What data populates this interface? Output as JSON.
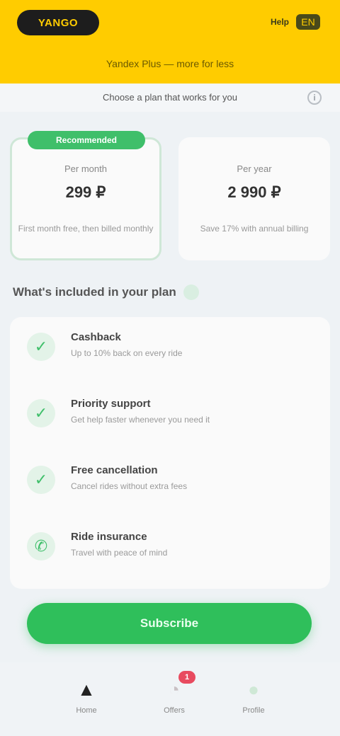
{
  "header": {
    "logo": "YANGO",
    "link": "Help",
    "lang": "EN",
    "subtitle": "Yandex Plus — more for less"
  },
  "strip": {
    "text": "Choose a plan that works for you",
    "info_icon": "info-icon",
    "info_glyph": "i"
  },
  "plans": [
    {
      "badge": "Recommended",
      "title": "Per month",
      "price": "299 ₽",
      "note": "First month free, then billed monthly"
    },
    {
      "title": "Per year",
      "price": "2 990 ₽",
      "note": "Save 17% with annual billing"
    }
  ],
  "section": {
    "title": "What's included in your plan"
  },
  "features": [
    {
      "icon": "check-circle-icon",
      "glyph": "✓",
      "title": "Cashback",
      "desc": "Up to 10% back on every ride"
    },
    {
      "icon": "shield-icon",
      "glyph": "✓",
      "title": "Priority support",
      "desc": "Get help faster whenever you need it"
    },
    {
      "icon": "check-icon",
      "glyph": "✓",
      "title": "Free cancellation",
      "desc": "Cancel rides without extra fees"
    },
    {
      "icon": "phone-icon",
      "glyph": "✆",
      "title": "Ride insurance",
      "desc": "Travel with peace of mind"
    }
  ],
  "cta": {
    "label": "Subscribe"
  },
  "nav": [
    {
      "icon": "home-icon",
      "glyph": "▲",
      "label": "Home"
    },
    {
      "icon": "bell-icon",
      "glyph": "◔",
      "label": "Offers",
      "badge": "1"
    },
    {
      "icon": "profile-icon",
      "glyph": "●",
      "label": "Profile"
    }
  ],
  "colors": {
    "brand_yellow": "#ffcc00",
    "accent_green": "#2fbf5b",
    "badge_red": "#e84a5f"
  }
}
